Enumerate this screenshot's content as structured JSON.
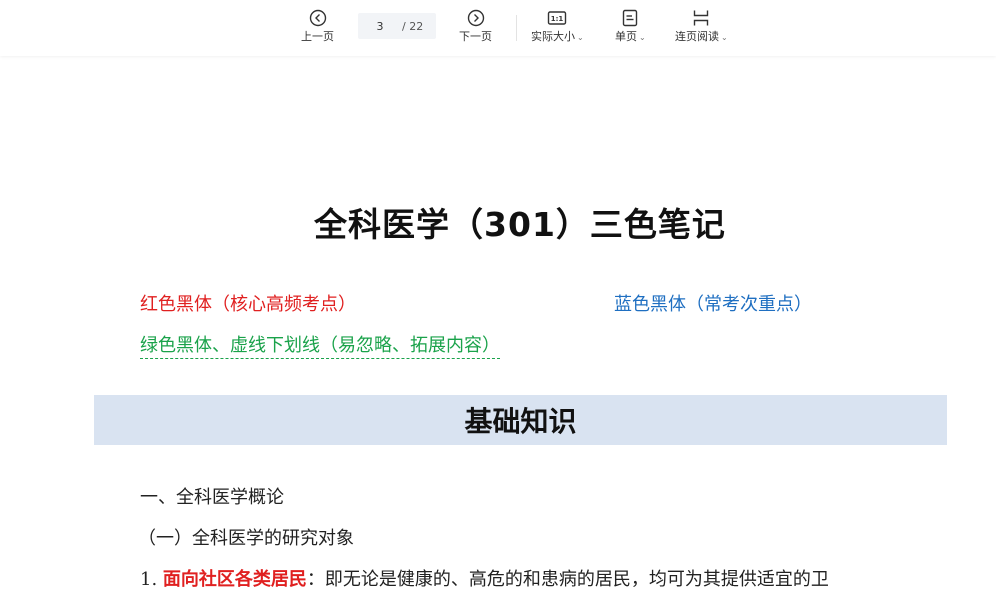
{
  "toolbar": {
    "prev_label": "上一页",
    "next_label": "下一页",
    "current_page": "3",
    "total_pages": "/ 22",
    "actual_size_label": "实际大小",
    "single_page_label": "单页",
    "continuous_label": "连页阅读",
    "actual_size_icon_text": "1:1"
  },
  "document": {
    "title": "全科医学（301）三色笔记",
    "legend_red": "红色黑体（核心高频考点）",
    "legend_blue": "蓝色黑体（常考次重点）",
    "legend_green": "绿色黑体、虚线下划线（易忽略、拓展内容）",
    "section_title": "基础知识",
    "line1": "一、全科医学概论",
    "line2": "（一）全科医学的研究对象",
    "line3_num": "1.",
    "line3_red": "面向社区各类居民",
    "line3_rest": "：即无论是健康的、高危的和患病的居民，均可为其提供适宜的卫"
  },
  "colors": {
    "red": "#e02020",
    "blue": "#1f6fc1",
    "green": "#1aa24a",
    "band": "#d9e3f1"
  },
  "icons": {
    "prev": "circle-chevron-left-icon",
    "next": "circle-chevron-right-icon",
    "actual_size": "actual-size-icon",
    "single_page": "single-page-icon",
    "continuous": "continuous-page-icon"
  }
}
